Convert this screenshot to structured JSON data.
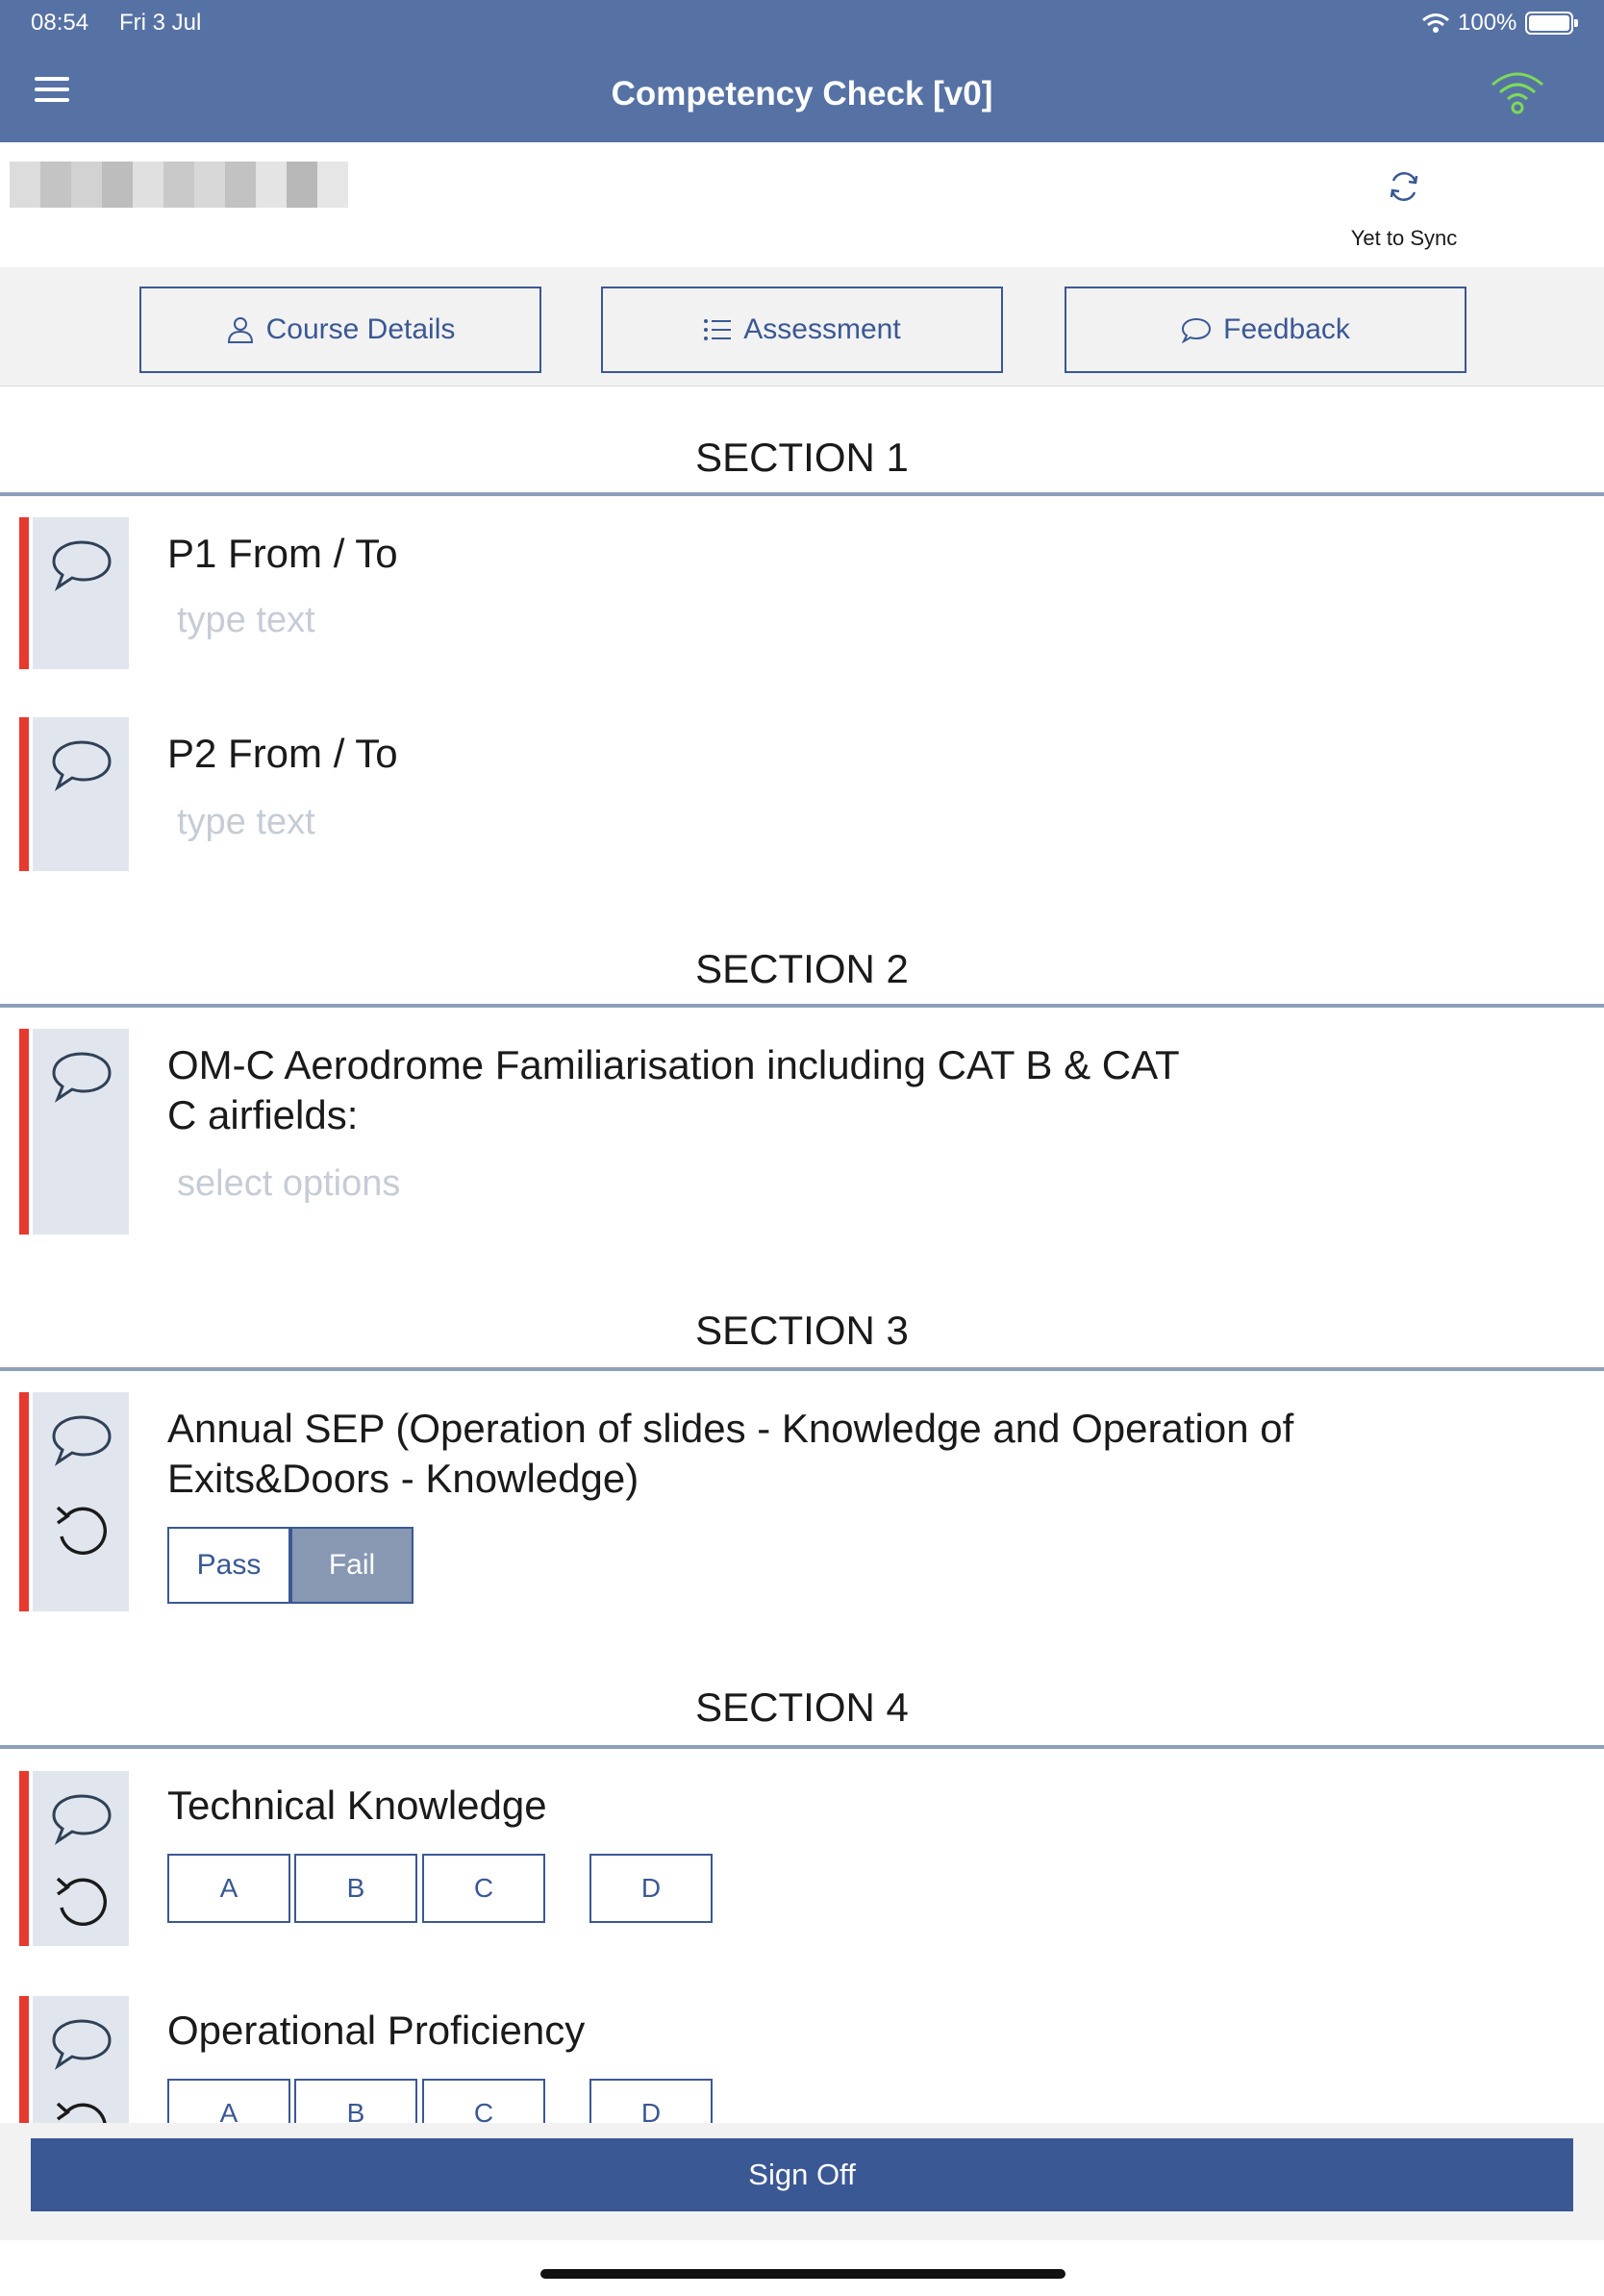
{
  "status_bar": {
    "time": "08:54",
    "date": "Fri 3 Jul",
    "battery": "100%"
  },
  "header": {
    "title": "Competency Check [v0]"
  },
  "sync": {
    "label": "Yet to Sync"
  },
  "tabs": [
    {
      "label": "Course Details",
      "icon": "person-icon"
    },
    {
      "label": "Assessment",
      "icon": "list-icon"
    },
    {
      "label": "Feedback",
      "icon": "speech-bubble-icon"
    }
  ],
  "sections": [
    {
      "title": "SECTION 1",
      "items": [
        {
          "question": "P1 From / To",
          "placeholder": "type text"
        },
        {
          "question": "P2 From / To",
          "placeholder": "type text"
        }
      ]
    },
    {
      "title": "SECTION 2",
      "items": [
        {
          "question_line1": "OM-C Aerodrome Familiarisation including CAT B & CAT",
          "question_line2": "C airfields:",
          "placeholder": "select options"
        }
      ]
    },
    {
      "title": "SECTION 3",
      "items": [
        {
          "question_line1": "Annual SEP (Operation of slides - Knowledge and Operation of",
          "question_line2": "Exits&Doors - Knowledge)",
          "options": [
            "Pass",
            "Fail"
          ],
          "selected": "Fail"
        }
      ]
    },
    {
      "title": "SECTION 4",
      "items": [
        {
          "question": "Technical Knowledge",
          "grades": [
            "A",
            "B",
            "C",
            "D"
          ]
        },
        {
          "question": "Operational Proficiency",
          "grades": [
            "A",
            "B",
            "C",
            "D"
          ]
        }
      ]
    }
  ],
  "footer": {
    "sign_off_label": "Sign Off"
  },
  "colors": {
    "header_bg": "#5672a4",
    "accent": "#3a5894",
    "required_bar": "#e8392f",
    "connected_green": "#7ed957"
  }
}
